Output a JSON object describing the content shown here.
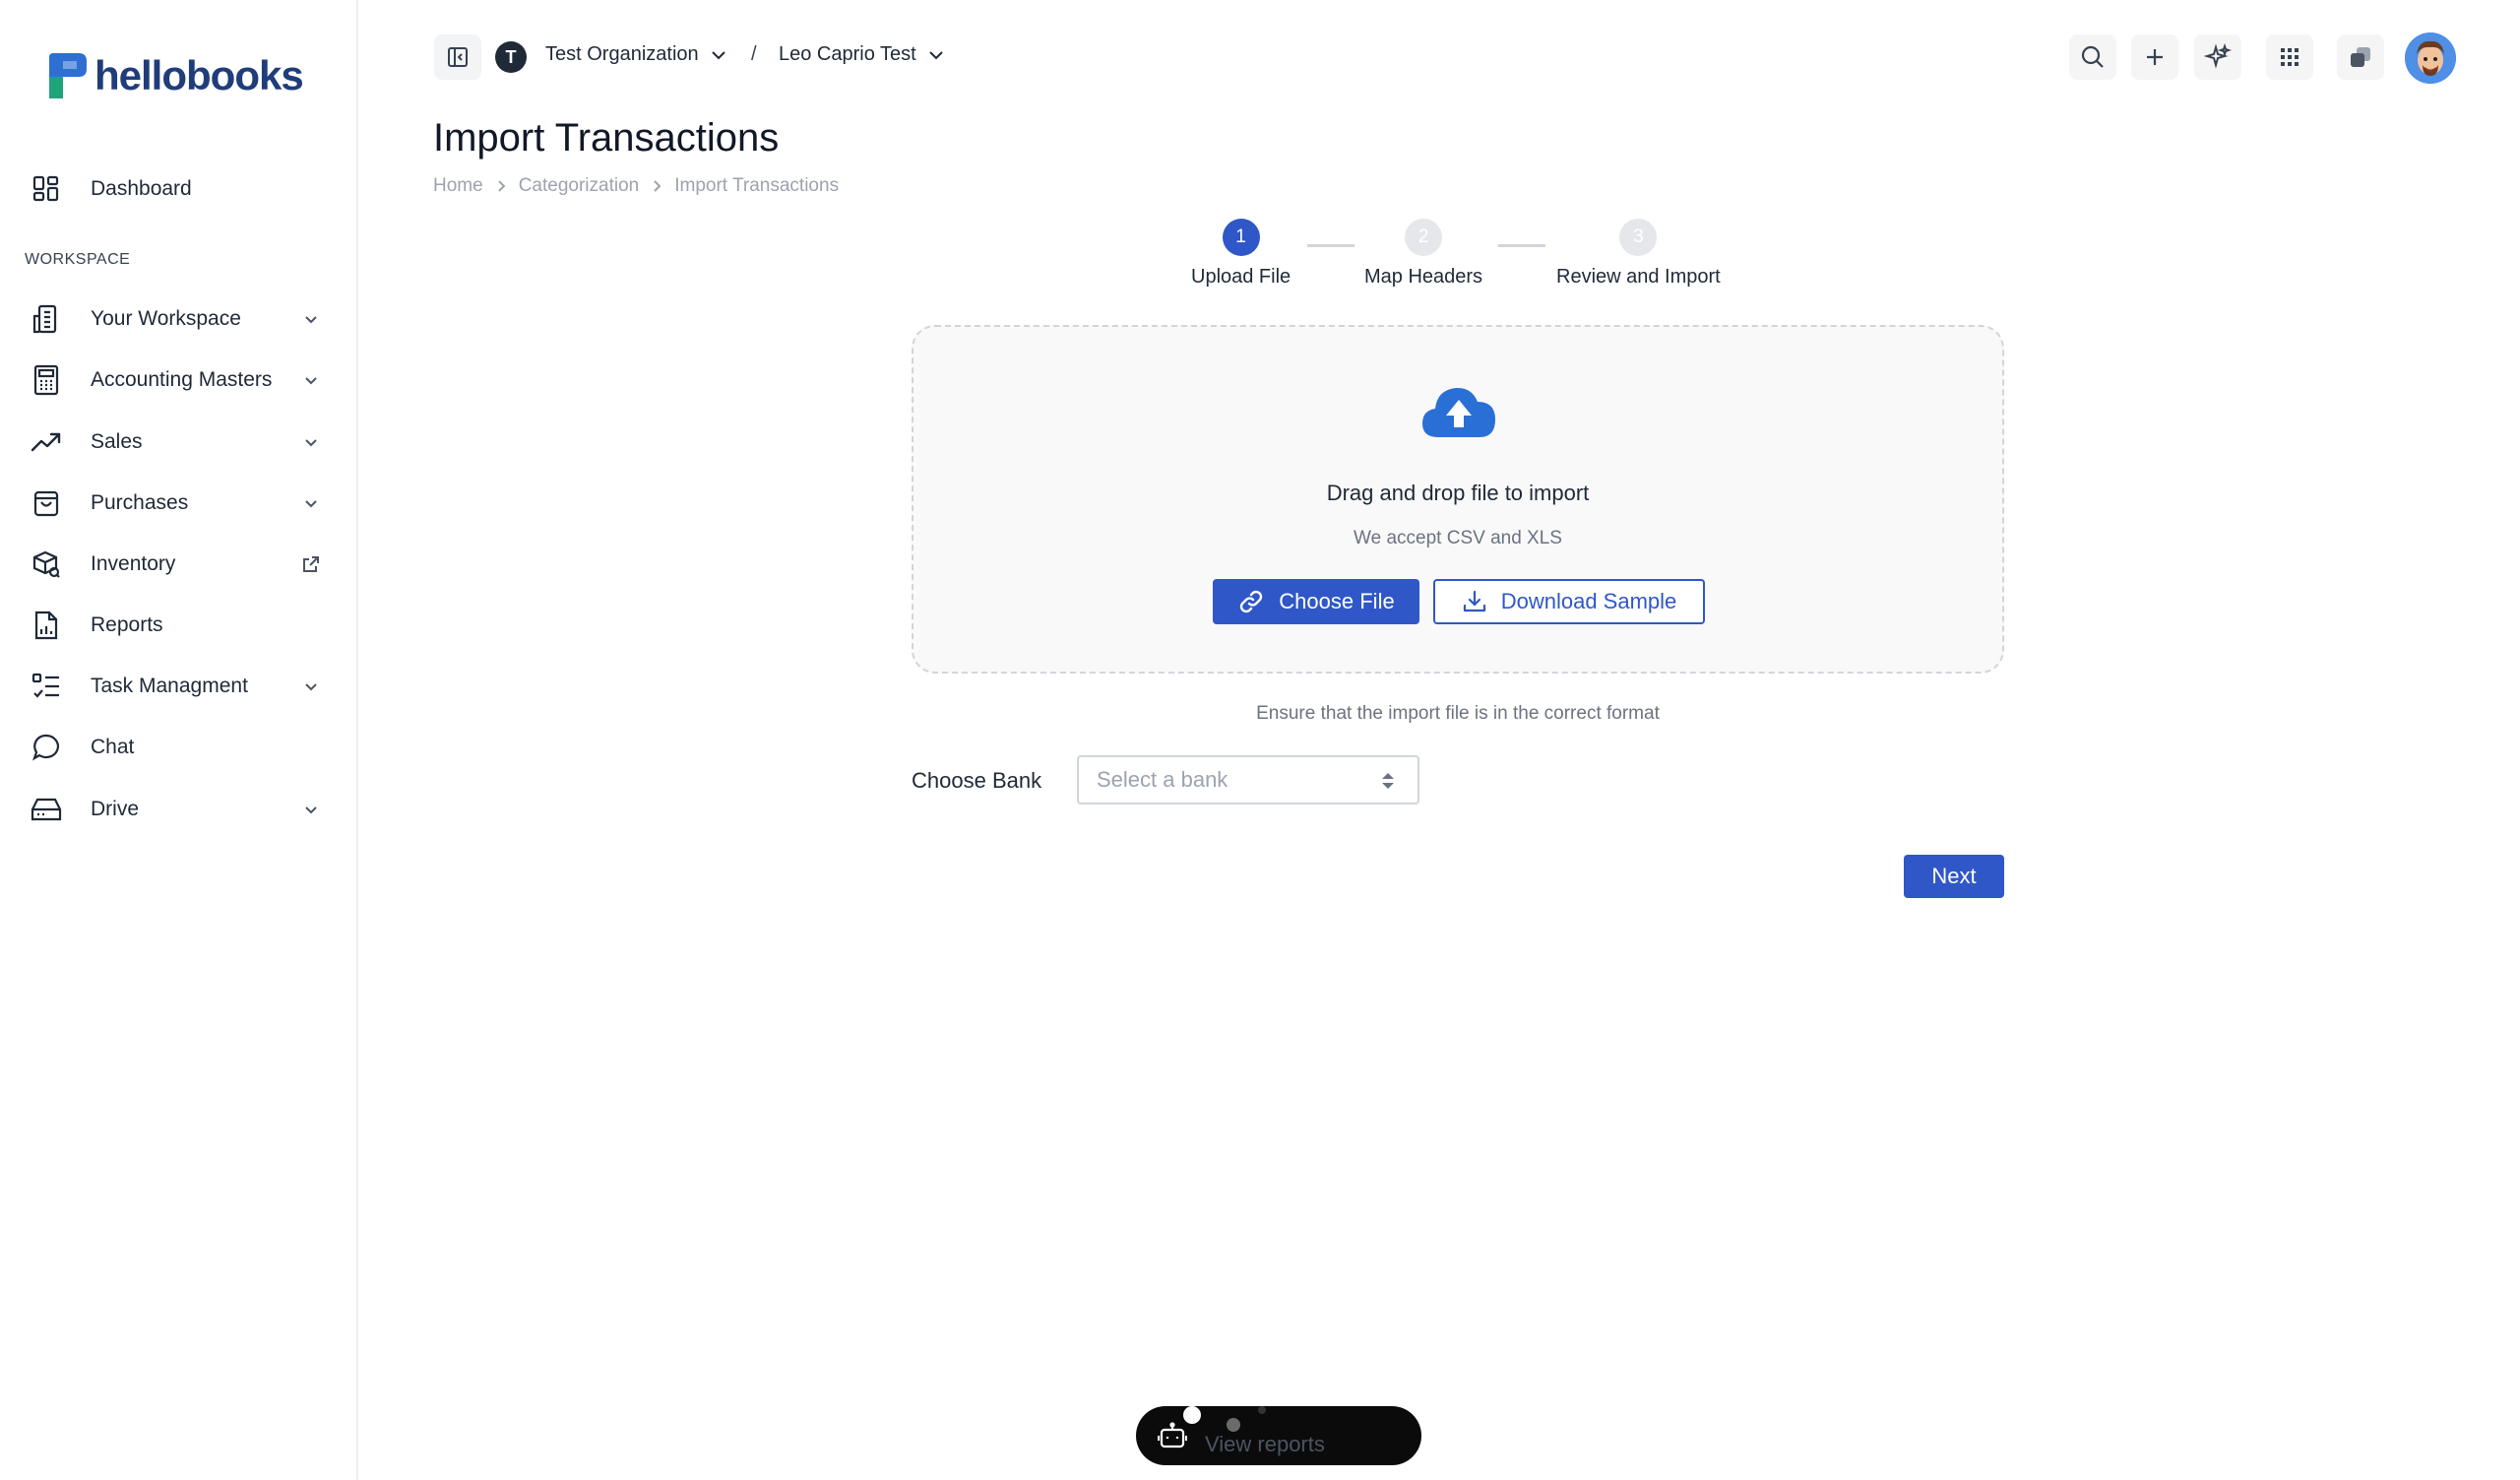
{
  "brand": {
    "name": "hellobooks",
    "primary_color": "#2f57c8",
    "logo_color": "#1f3d7a"
  },
  "sidebar": {
    "top_item": {
      "label": "Dashboard",
      "icon": "dashboard-grid-icon"
    },
    "section_label": "WORKSPACE",
    "items": [
      {
        "label": "Your Workspace",
        "icon": "building-icon",
        "trailing": "chevron-down"
      },
      {
        "label": "Accounting Masters",
        "icon": "calculator-icon",
        "trailing": "chevron-down"
      },
      {
        "label": "Sales",
        "icon": "trending-up-icon",
        "trailing": "chevron-down"
      },
      {
        "label": "Purchases",
        "icon": "shopping-bag-icon",
        "trailing": "chevron-down"
      },
      {
        "label": "Inventory",
        "icon": "package-icon",
        "trailing": "external-link"
      },
      {
        "label": "Reports",
        "icon": "report-document-icon",
        "trailing": ""
      },
      {
        "label": "Task Managment",
        "icon": "task-list-icon",
        "trailing": "chevron-down"
      },
      {
        "label": "Chat",
        "icon": "chat-bubble-icon",
        "trailing": ""
      },
      {
        "label": "Drive",
        "icon": "hard-drive-icon",
        "trailing": "chevron-down"
      }
    ]
  },
  "topbar": {
    "org_initial": "T",
    "org_name": "Test Organization",
    "separator": "/",
    "client_name": "Leo Caprio Test",
    "actions": [
      "search-icon",
      "plus-icon",
      "sparkles-icon",
      "apps-grid-icon",
      "switch-app-icon"
    ]
  },
  "page": {
    "title": "Import Transactions",
    "breadcrumb": [
      "Home",
      "Categorization",
      "Import Transactions"
    ]
  },
  "stepper": {
    "current_step": 1,
    "steps": [
      {
        "number": "1",
        "label": "Upload File"
      },
      {
        "number": "2",
        "label": "Map Headers"
      },
      {
        "number": "3",
        "label": "Review and Import"
      }
    ]
  },
  "upload": {
    "title": "Drag and drop file to import",
    "subtitle": "We accept CSV and XLS",
    "choose_file_label": "Choose File",
    "download_sample_label": "Download Sample",
    "format_note": "Ensure that the import file is in the correct format"
  },
  "bank": {
    "label": "Choose Bank",
    "placeholder": "Select a bank"
  },
  "next_label": "Next",
  "floating_widget": {
    "label": "View reports"
  }
}
